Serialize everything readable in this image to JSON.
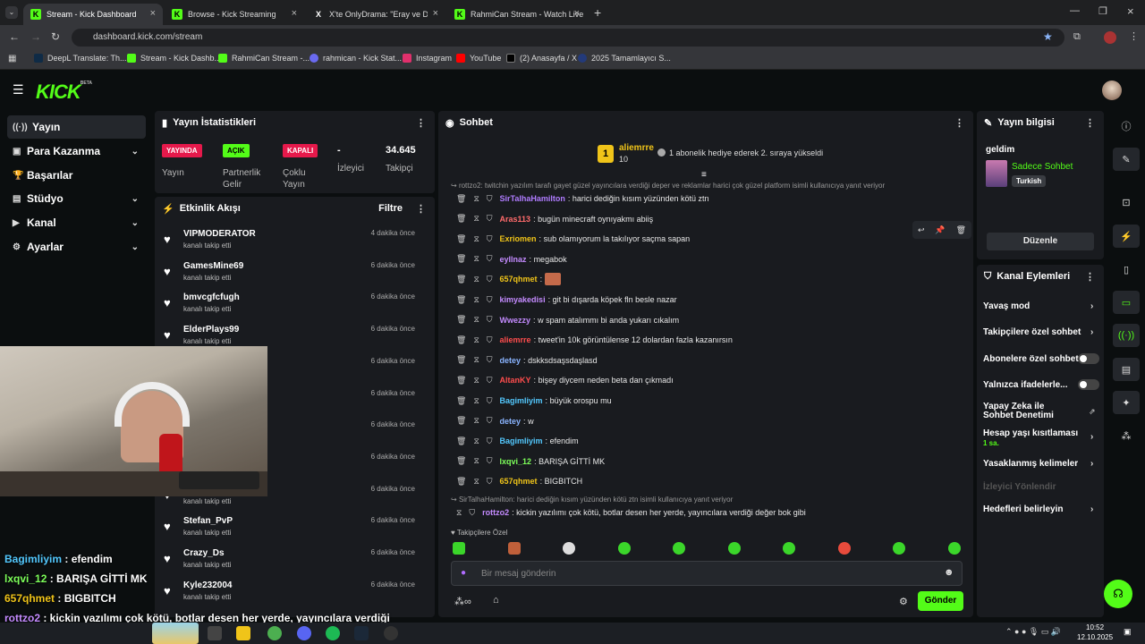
{
  "browser": {
    "tabs": [
      {
        "label": "Stream - Kick Dashboard",
        "active": true
      },
      {
        "label": "Browse - Kick Streaming"
      },
      {
        "label": "X'te OnlyDrama: \"Eray ve Dizci,"
      },
      {
        "label": "RahmiCan Stream - Watch Live"
      }
    ],
    "url": "dashboard.kick.com/stream",
    "bookmarks": [
      "DeepL Translate: Th...",
      "Stream - Kick Dashb...",
      "RahmiCan Stream -...",
      "rahmican - Kick Stat...",
      "Instagram",
      "YouTube",
      "(2) Anasayfa / X",
      "2025 Tamamlayıcı S..."
    ]
  },
  "brand": {
    "logo": "KICK",
    "beta": "BETA"
  },
  "nav": [
    "Yayın",
    "Para Kazanma",
    "Başarılar",
    "Stüdyo",
    "Kanal",
    "Ayarlar"
  ],
  "stats": {
    "title": "Yayın İstatistikleri",
    "items": [
      {
        "badge": "YAYINDA",
        "label": "Yayın"
      },
      {
        "badge": "AÇIK",
        "label": "Partnerlik Gelir"
      },
      {
        "badge": "KAPALI",
        "label": "Çoklu Yayın"
      },
      {
        "value": "-",
        "label": "İzleyici"
      },
      {
        "value": "34.645",
        "label": "Takipçi"
      }
    ]
  },
  "activity": {
    "title": "Etkinlik Akışı",
    "filter": "Filtre",
    "items": [
      {
        "name": "VIPMODERATOR",
        "sub": "kanalı takip etti",
        "time": "4 dakika önce"
      },
      {
        "name": "GamesMine69",
        "sub": "kanalı takip etti",
        "time": "6 dakika önce"
      },
      {
        "name": "bmvcgfcfugh",
        "sub": "kanalı takip etti",
        "time": "6 dakika önce"
      },
      {
        "name": "ElderPlays99",
        "sub": "kanalı takip etti",
        "time": "6 dakika önce"
      },
      {
        "name": "",
        "sub": "",
        "time": "6 dakika önce"
      },
      {
        "name": "",
        "sub": "",
        "time": "6 dakika önce"
      },
      {
        "name": "",
        "sub": "",
        "time": "6 dakika önce"
      },
      {
        "name": "",
        "sub": "",
        "time": "6 dakika önce"
      },
      {
        "name": "",
        "sub": "kanalı takip etti",
        "time": "6 dakika önce"
      },
      {
        "name": "Stefan_PvP",
        "sub": "kanalı takip etti",
        "time": "6 dakika önce"
      },
      {
        "name": "Crazy_Ds",
        "sub": "kanalı takip etti",
        "time": "6 dakika önce"
      },
      {
        "name": "Kyle232004",
        "sub": "kanalı takip etti",
        "time": "6 dakika önce"
      }
    ]
  },
  "chat": {
    "title": "Sohbet",
    "pinned_user": "aliemrre",
    "pinned_count": "10",
    "pinned_rank": "1",
    "pinned_text": "1 abonelik hediye ederek 2. sıraya yükseldi",
    "reply_top": "rottzo2: twitchin yazılım tarafı gayet güzel yayıncılara verdiği deper ve reklamlar harici çok güzel platform isimli kullanıcıya yanıt veriyor",
    "messages": [
      {
        "user": "SirTalhaHamilton",
        "color": "#b07cff",
        "text": "harici dediğin kısım yüzünden kötü ztn"
      },
      {
        "user": "Aras113",
        "color": "#ff6b6b",
        "text": "bugün minecraft oynıyakmı abiiş"
      },
      {
        "user": "Exriomen",
        "color": "#f0c419",
        "text": "sub olamıyorum la takılıyor saçma sapan"
      },
      {
        "user": "eyllnaz",
        "color": "#c48bff",
        "text": "megabok"
      },
      {
        "user": "657qhmet",
        "color": "#f0c419",
        "text": ""
      },
      {
        "user": "kimyakedisi",
        "color": "#c48bff",
        "text": "git bi dışarda köpek fln besle nazar"
      },
      {
        "user": "Wwezzy",
        "color": "#c48bff",
        "text": "w spam atalımmı bi anda yukarı cıkalım"
      },
      {
        "user": "aliemrre",
        "color": "#ff4d4d",
        "text": "tweet'in 10k görüntülense 12 dolardan fazla kazanırsın"
      },
      {
        "user": "detey",
        "color": "#8ab4ff",
        "text": "dskksdsaşsdaşlasd"
      },
      {
        "user": "AltanKY",
        "color": "#ff4d4d",
        "text": "bişey diycem neden beta dan çıkmadı"
      },
      {
        "user": "Bagimliyim",
        "color": "#53c9ff",
        "text": "büyük orospu mu"
      },
      {
        "user": "detey",
        "color": "#8ab4ff",
        "text": "w"
      },
      {
        "user": "Bagimliyim",
        "color": "#53c9ff",
        "text": "efendim"
      },
      {
        "user": "lxqvi_12",
        "color": "#7dff5a",
        "text": "BARIŞA GİTTİ MK"
      },
      {
        "user": "657qhmet",
        "color": "#f0c419",
        "text": "BIGBITCH"
      }
    ],
    "reply_bottom": "SirTalhaHamilton: harici dediğin kısım yüzünden kötü ztn isimli kullanıcıya yanıt veriyor",
    "last": {
      "user": "rottzo2",
      "color": "#c48bff",
      "text": "kickin yazılımı çok kötü, botlar desen her yerde, yayıncılara verdiği değer bok gibi"
    },
    "follower_only": "Takipçilere Özel",
    "input_placeholder": "Bir mesaj gönderin",
    "send": "Gönder"
  },
  "info": {
    "title": "Yayın bilgisi",
    "stream_title": "geldim",
    "category": "Sadece Sohbet",
    "language": "Turkish",
    "edit": "Düzenle"
  },
  "actions": {
    "title": "Kanal Eylemleri",
    "items": [
      "Yavaş mod",
      "Takipçilere özel sohbet",
      "Abonelere özel sohbet",
      "Yalnızca ifadelerle...",
      "Yapay Zeka ile Sohbet Denetimi",
      "Hesap yaşı kısıtlaması",
      "Yasaklanmış kelimeler",
      "İzleyici Yönlendir",
      "Hedefleri belirleyin"
    ],
    "age_limit": "1 sa."
  },
  "overlay": [
    {
      "user": "Bagimliyim",
      "color": "#53c9ff",
      "text": " : efendim"
    },
    {
      "user": "lxqvi_12",
      "color": "#7dff5a",
      "text": " : BARIŞA GİTTİ MK"
    },
    {
      "user": "657qhmet",
      "color": "#f0c419",
      "text": " : BIGBITCH"
    },
    {
      "user": "rottzo2",
      "color": "#c48bff",
      "text": " : kickin yazılımı çok kötü, botlar desen her yerde, yayıncılara verdiği"
    },
    {
      "user": "",
      "color": "#fff",
      "text": "değer bok gibi"
    }
  ],
  "taskbar": {
    "time": "10:52",
    "date": "12.10.2025"
  },
  "colors": {
    "accent": "#53fc18",
    "panel": "#191b1f",
    "bg": "#0b0e0f"
  }
}
